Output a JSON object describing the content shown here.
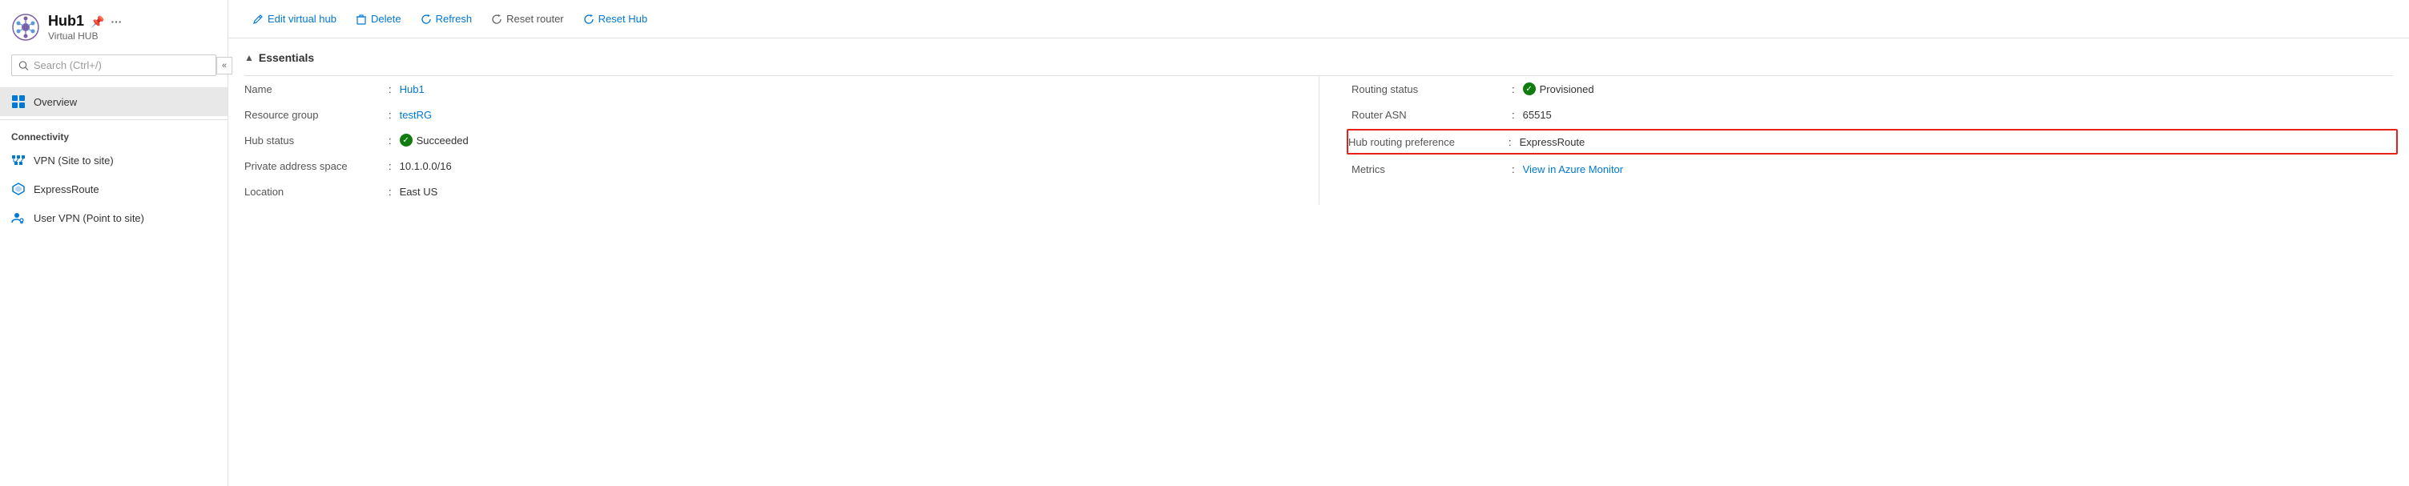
{
  "sidebar": {
    "app_title": "Hub1",
    "app_subtitle": "Virtual HUB",
    "search_placeholder": "Search (Ctrl+/)",
    "collapse_icon": "«",
    "nav_items": [
      {
        "id": "overview",
        "label": "Overview",
        "icon": "grid",
        "active": true
      }
    ],
    "connectivity_label": "Connectivity",
    "connectivity_items": [
      {
        "id": "vpn",
        "label": "VPN (Site to site)",
        "icon": "vpn"
      },
      {
        "id": "expressroute",
        "label": "ExpressRoute",
        "icon": "expressroute"
      },
      {
        "id": "uservpn",
        "label": "User VPN (Point to site)",
        "icon": "uservpn"
      }
    ]
  },
  "toolbar": {
    "edit_label": "Edit virtual hub",
    "delete_label": "Delete",
    "refresh_label": "Refresh",
    "reset_router_label": "Reset router",
    "reset_hub_label": "Reset Hub"
  },
  "essentials": {
    "section_title": "Essentials",
    "fields_left": [
      {
        "label": "Name",
        "value": "Hub1",
        "link": true
      },
      {
        "label": "Resource group",
        "value": "testRG",
        "link": true
      },
      {
        "label": "Hub status",
        "value": "Succeeded",
        "status": "success"
      },
      {
        "label": "Private address space",
        "value": "10.1.0.0/16"
      },
      {
        "label": "Location",
        "value": "East US"
      }
    ],
    "fields_right": [
      {
        "label": "Routing status",
        "value": "Provisioned",
        "status": "success"
      },
      {
        "label": "Router ASN",
        "value": "65515"
      },
      {
        "label": "Hub routing preference",
        "value": "ExpressRoute",
        "highlight": true
      },
      {
        "label": "Metrics",
        "value": "View in Azure Monitor",
        "link": true
      }
    ]
  }
}
